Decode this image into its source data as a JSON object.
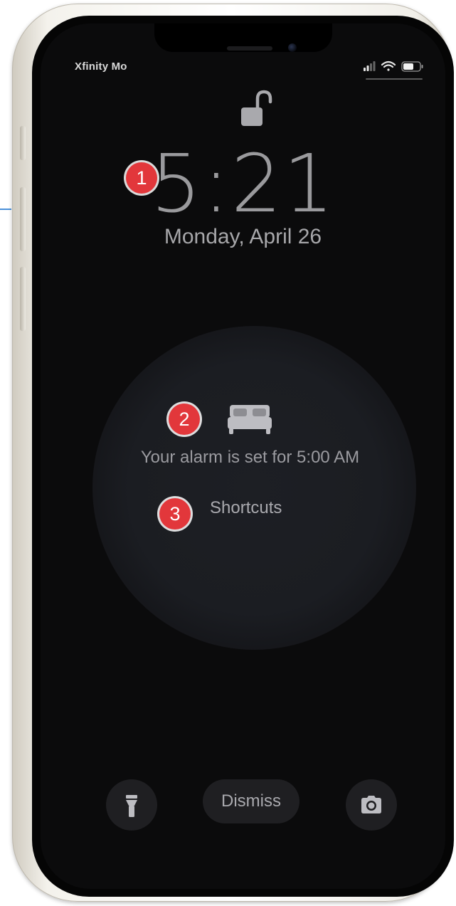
{
  "status_bar": {
    "carrier": "Xfinity Mo",
    "icons": [
      "signal-icon",
      "wifi-icon",
      "battery-icon"
    ]
  },
  "lock_screen": {
    "time": "5:21",
    "date": "Monday, April 26",
    "lock_icon": "unlocked-padlock-icon"
  },
  "sleep_widget": {
    "icon": "bed-icon",
    "alarm_text": "Your alarm is set for 5:00 AM",
    "shortcuts_label": "Shortcuts"
  },
  "bottom_controls": {
    "flashlight_icon": "flashlight-icon",
    "dismiss_label": "Dismiss",
    "camera_icon": "camera-icon"
  },
  "callouts": {
    "badge_1": "1",
    "badge_2": "2",
    "badge_3": "3",
    "color": "#e2373b"
  }
}
